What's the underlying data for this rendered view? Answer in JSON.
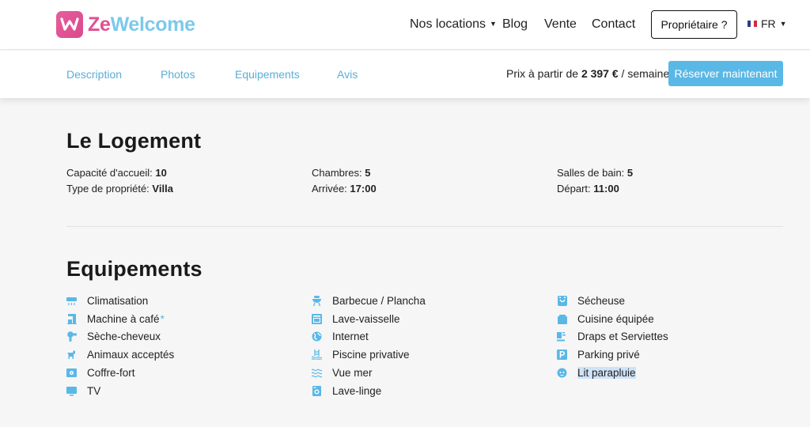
{
  "brand": {
    "ze": "Ze",
    "welcome": "Welcome"
  },
  "nav": {
    "locations": "Nos locations",
    "blog": "Blog",
    "sale": "Vente",
    "contact": "Contact",
    "owner": "Propriétaire ?",
    "lang": "FR"
  },
  "tabs": {
    "description": "Description",
    "photos": "Photos",
    "equipment": "Equipements",
    "reviews": "Avis"
  },
  "price": {
    "prefix": "Prix à partir de",
    "amount": "2 397 €",
    "suffix": "/ semaine"
  },
  "book_label": "Réserver maintenant",
  "lodging": {
    "title": "Le Logement",
    "capacity_label": "Capacité d'accueil:",
    "capacity_value": "10",
    "type_label": "Type de propriété:",
    "type_value": "Villa",
    "rooms_label": "Chambres:",
    "rooms_value": "5",
    "arrival_label": "Arrivée:",
    "arrival_value": "17:00",
    "baths_label": "Salles de bain:",
    "baths_value": "5",
    "departure_label": "Départ:",
    "departure_value": "11:00"
  },
  "equipment": {
    "title": "Equipements",
    "items": [
      "Climatisation",
      "Machine à café",
      "Sèche-cheveux",
      "Animaux acceptés",
      "Coffre-fort",
      "TV",
      "Barbecue / Plancha",
      "Lave-vaisselle",
      "Internet",
      "Piscine privative",
      "Vue mer",
      "Lave-linge",
      "Sécheuse",
      "Cuisine équipée",
      "Draps et Serviettes",
      "Parking privé",
      "Lit parapluie"
    ],
    "asterisk": "*"
  },
  "colors": {
    "accent": "#5ab8e6",
    "brand_pink": "#e24e93",
    "brand_blue": "#7cc9ea",
    "icon": "#5ab8e6"
  }
}
